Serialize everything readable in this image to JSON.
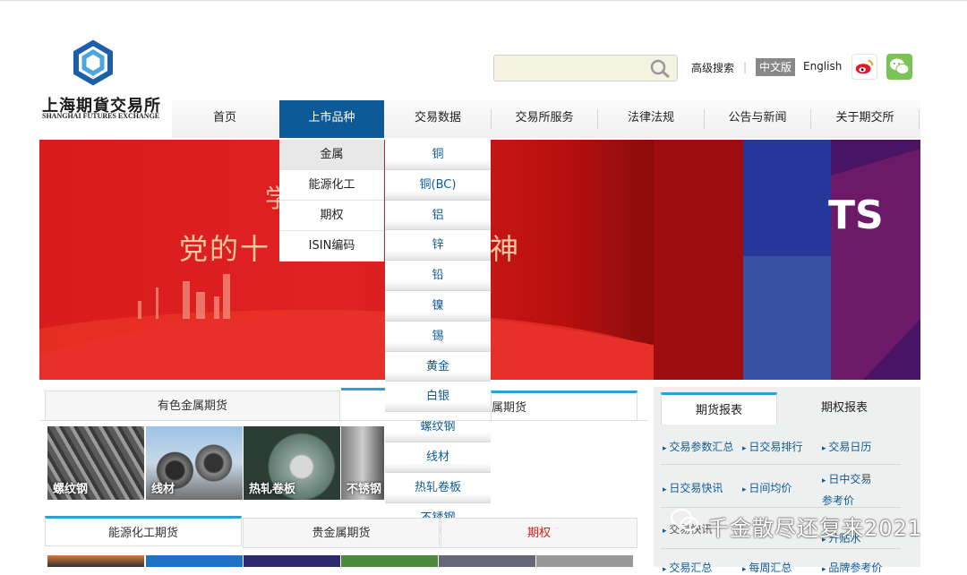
{
  "brand": {
    "name": "上海期貨交易所",
    "sub": "SHANGHAI FUTURES EXCHANGE"
  },
  "header": {
    "search_placeholder": "",
    "advanced_search": "高级搜索",
    "separator": "|",
    "lang_cn": "中文版",
    "lang_en": "English"
  },
  "nav": [
    "首页",
    "上市品种",
    "交易数据",
    "交易所服务",
    "法律法规",
    "公告与新闻",
    "关于期交所"
  ],
  "submenu_categories": [
    "金属",
    "能源化工",
    "期权",
    "ISIN编码"
  ],
  "submenu_products": [
    "铜",
    "铜(BC)",
    "铝",
    "锌",
    "铅",
    "镍",
    "锡",
    "黄金",
    "白银",
    "螺纹钢",
    "线材",
    "热轧卷板",
    "不锈钢"
  ],
  "banner": {
    "line1": "学",
    "line2_left": "党的十",
    "line2_right": "神",
    "right_text": "TS"
  },
  "left_tabs_row1": [
    "有色金属期货",
    "属期货"
  ],
  "left_thumbs": [
    "螺纹钢",
    "线材",
    "热轧卷板",
    "不锈钢"
  ],
  "left_tabs_row2": [
    "能源化工期货",
    "贵金属期货",
    "期权"
  ],
  "right_tabs": [
    "期货报表",
    "期权报表"
  ],
  "right_links": [
    [
      "交易参数汇总",
      "日交易排行",
      "交易日历"
    ],
    [
      "日交易快讯",
      "日间均价",
      "日中交易参考价"
    ],
    [
      "交易快讯",
      "",
      "升贴水"
    ],
    [
      "交易汇总",
      "每周汇总",
      "品牌参考价"
    ]
  ],
  "watermark": "千金散尽还复来2021",
  "colors": {
    "nav_active": "#0e5a96",
    "accent_tab": "#2ba1db",
    "link": "#0e5a96",
    "banner_red": "#d81b1b"
  }
}
